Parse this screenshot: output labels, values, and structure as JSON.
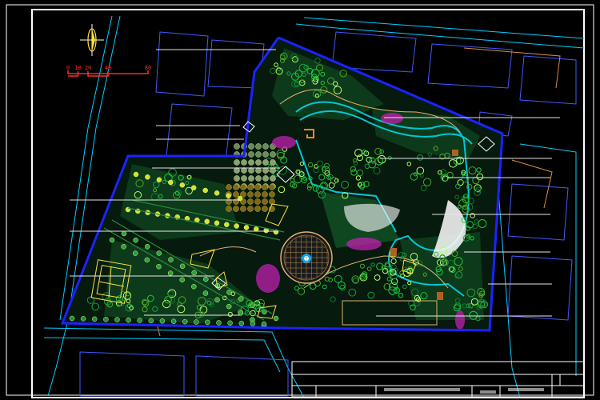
{
  "scale_bar": {
    "ticks": [
      "0",
      "10",
      "20",
      "40",
      "80"
    ],
    "color": "#ff2a2a"
  },
  "colors": {
    "site_boundary": "#1a24ff",
    "frame": "#ffffff",
    "road_lines": "#00d0ff",
    "buildings": "#3f5aff",
    "water": "#00c8d8",
    "lawn_dark": "#0a3a1a",
    "tree_green": "#19c93a",
    "tree_light": "#b5ff6a",
    "flower_magenta": "#ff2ad4",
    "path_tan": "#e0b070",
    "leader_line": "#e6e6e6"
  },
  "icons": {
    "north_arrow": "north-arrow-icon",
    "fountain_plaza": "circular-plaza-icon"
  },
  "title_block": {
    "cells": [
      "",
      "",
      "",
      "",
      "",
      ""
    ]
  }
}
